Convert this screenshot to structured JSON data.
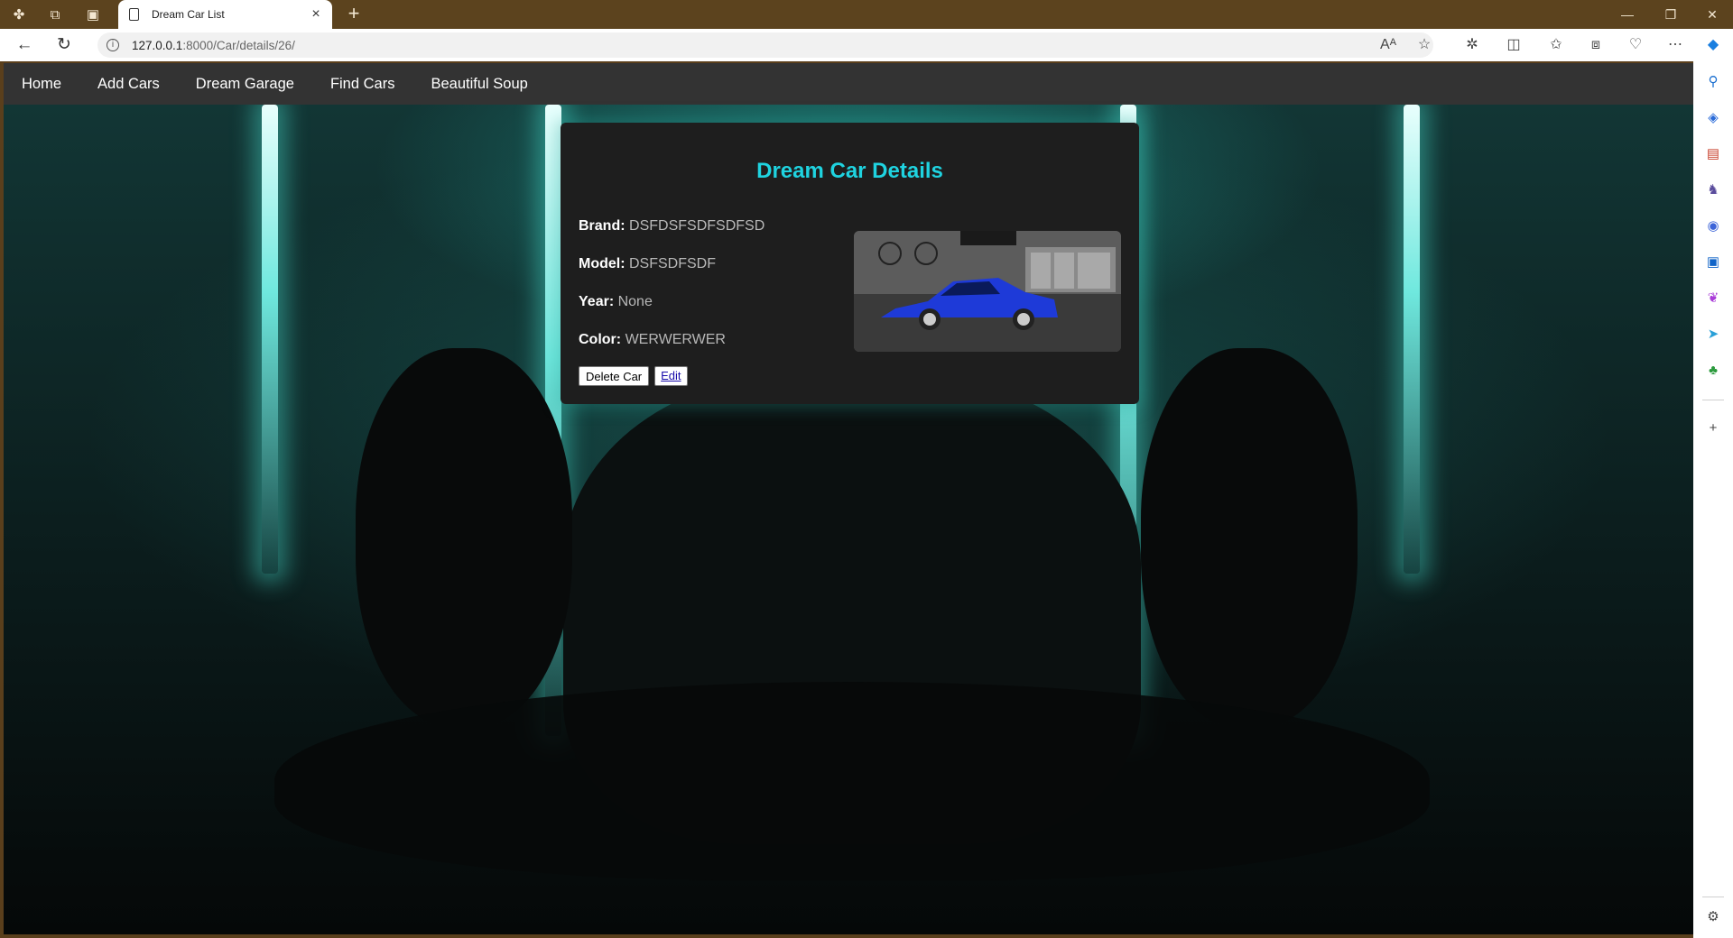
{
  "browser": {
    "tab_title": "Dream Car List",
    "url_host": "127.0.0.1",
    "url_path": ":8000/Car/details/26/"
  },
  "nav": {
    "items": [
      "Home",
      "Add Cars",
      "Dream Garage",
      "Find Cars",
      "Beautiful Soup"
    ]
  },
  "card": {
    "title": "Dream Car Details",
    "fields": [
      {
        "label": "Brand:",
        "value": "DSFDSFSDFSDFSD"
      },
      {
        "label": "Model:",
        "value": "DSFSDFSDF"
      },
      {
        "label": "Year:",
        "value": "None"
      },
      {
        "label": "Color:",
        "value": "WERWERWER"
      }
    ],
    "delete_label": "Delete Car",
    "edit_label": "Edit"
  },
  "colors": {
    "title_cyan": "#1fd3e0",
    "nav_bg": "#333333",
    "card_bg": "#1e1e1e",
    "browser_frame": "#5c431e"
  },
  "icons": {
    "sidebar": [
      "search-icon",
      "tag-icon",
      "toolbox-icon",
      "chess-icon",
      "circle-icon",
      "outlook-icon",
      "drop-icon",
      "send-icon",
      "tree-icon",
      "plus-icon",
      "settings-icon"
    ]
  }
}
